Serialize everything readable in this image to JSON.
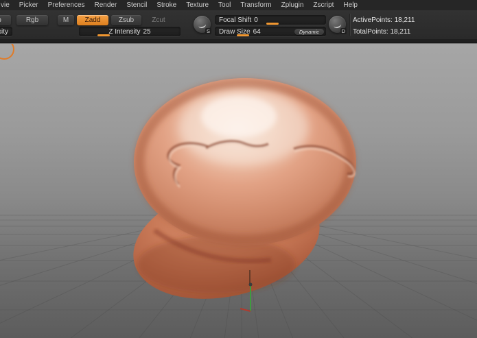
{
  "menu_bar": {
    "items": [
      "vie",
      "Picker",
      "Preferences",
      "Render",
      "Stencil",
      "Stroke",
      "Texture",
      "Tool",
      "Transform",
      "Zplugin",
      "Zscript",
      "Help"
    ]
  },
  "toolbar": {
    "mrgb_partial_label": "b",
    "rgb_label": "Rgb",
    "m_label": "M",
    "zadd_label": "Zadd",
    "zsub_label": "Zsub",
    "zcut_label": "Zcut",
    "rgb_intensity_partial_label": "sity",
    "z_intensity": {
      "label": "Z Intensity",
      "value": "25"
    },
    "focal_shift": {
      "label": "Focal Shift",
      "value": "0"
    },
    "draw_size": {
      "label": "Draw Size",
      "value": "64"
    },
    "dynamic_label": "Dynamic",
    "stroke_icon_label": "S",
    "depth_icon_label": "D",
    "active_points": "ActivePoints: 18,211",
    "total_points": "TotalPoints: 18,211"
  },
  "colors": {
    "accent_orange": "#ef9630",
    "zadd_orange": "#e8892c",
    "menu_bg": "#262626",
    "toolbar_bg": "#2e2e2e",
    "slider_bg": "#1f1f1f",
    "canvas_top_gray": "#a6a6a6",
    "canvas_bottom_gray": "#5c5c5c",
    "model_skin": "#d08a6b",
    "axis_green": "#3f9b3f",
    "axis_red": "#b23a2e"
  }
}
